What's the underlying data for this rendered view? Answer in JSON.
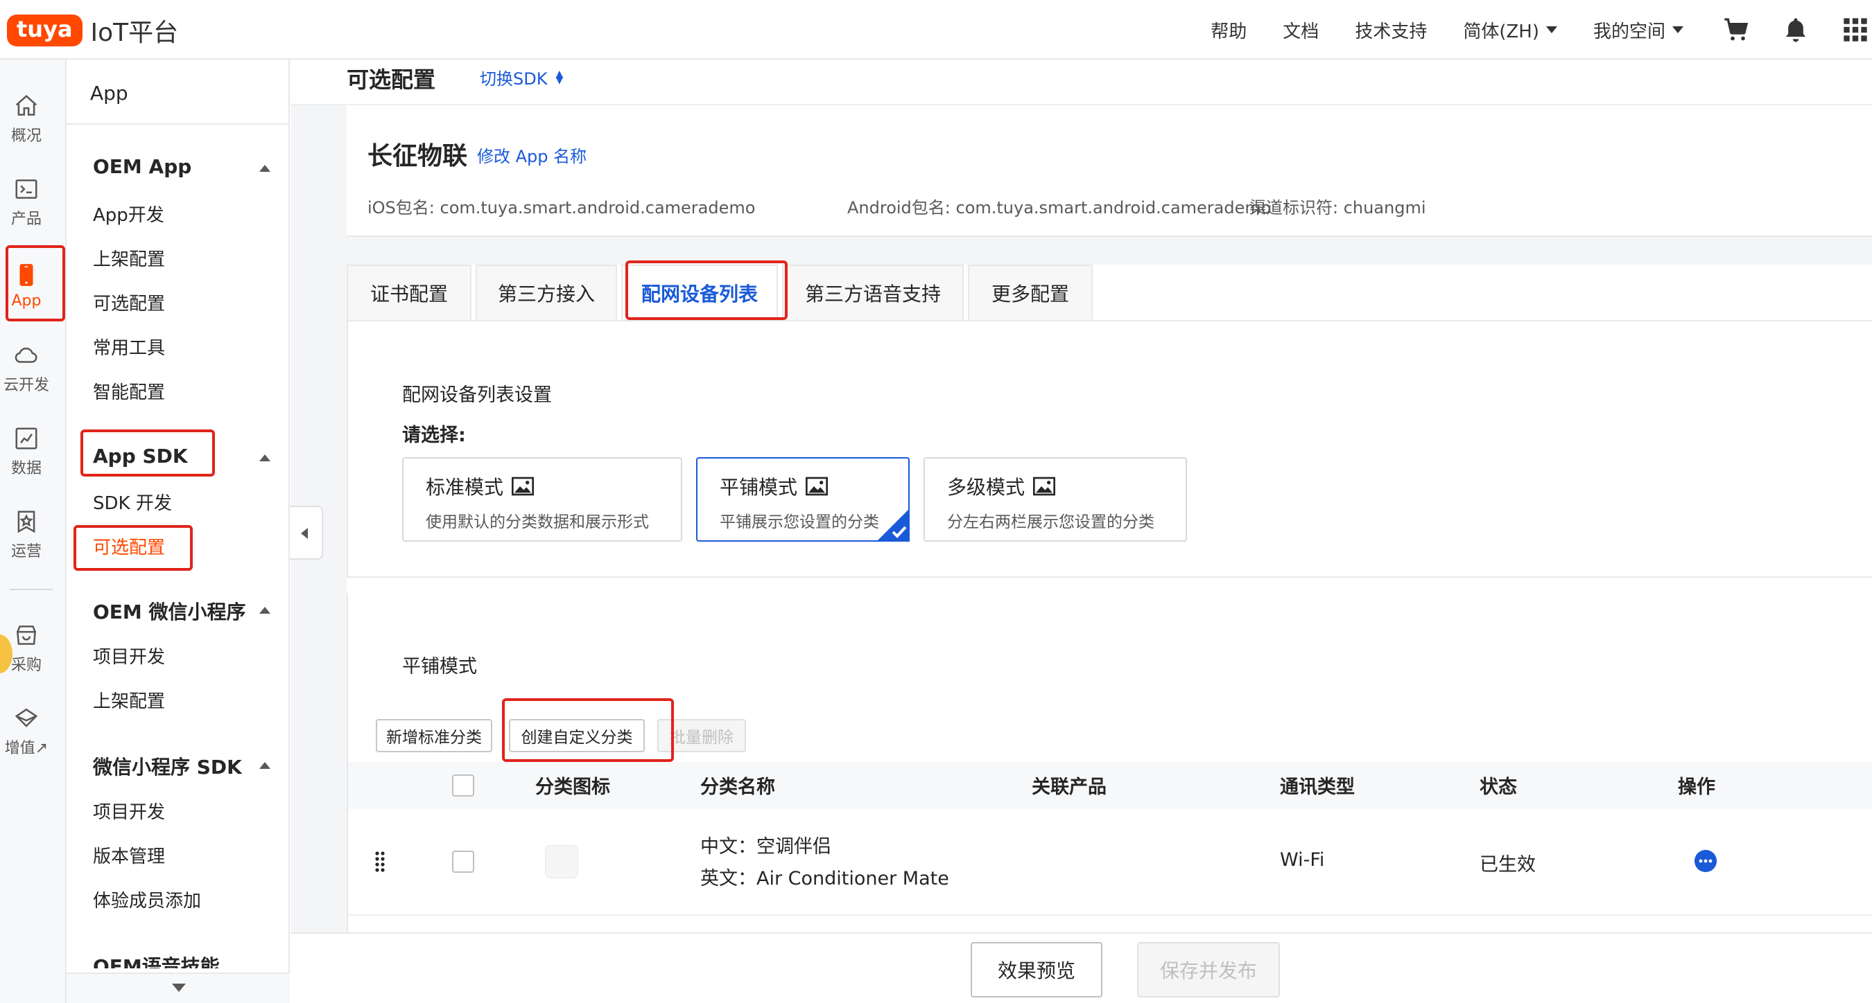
{
  "topbar": {
    "logo_badge": "tuya",
    "logo_text": "IoT平台",
    "links": {
      "help": "帮助",
      "docs": "文档",
      "support": "技术支持",
      "language": "简体(ZH)",
      "space": "我的空间"
    }
  },
  "rail": {
    "overview": "概况",
    "product": "产品",
    "app": "App",
    "cloud": "云开发",
    "data": "数据",
    "operation": "运营",
    "purchase": "采购",
    "value_added": "增值↗"
  },
  "sidebar": {
    "app": "App",
    "oem_app": "OEM App",
    "oem_items": [
      "App开发",
      "上架配置",
      "可选配置",
      "常用工具",
      "智能配置"
    ],
    "app_sdk": "App SDK",
    "sdk_items": [
      "SDK 开发",
      "可选配置"
    ],
    "oem_wechat": "OEM 微信小程序",
    "wechat_items": [
      "项目开发",
      "上架配置"
    ],
    "wechat_sdk": "微信小程序 SDK",
    "wechat_sdk_items": [
      "项目开发",
      "版本管理",
      "体验成员添加"
    ],
    "oem_voice": "OEM语音技能"
  },
  "page": {
    "title": "可选配置",
    "switch_sdk": "切换SDK"
  },
  "app_info": {
    "name": "长征物联",
    "rename": "修改 App 名称",
    "ios_pkg": "iOS包名: com.tuya.smart.android.camerademo",
    "android_pkg": "Android包名: com.tuya.smart.android.camerademo",
    "channel": "渠道标识符: chuangmi"
  },
  "tabs": [
    "证书配置",
    "第三方接入",
    "配网设备列表",
    "第三方语音支持",
    "更多配置"
  ],
  "device_list": {
    "title": "配网设备列表设置",
    "choose": "请选择:",
    "modes": [
      {
        "title": "标准模式",
        "desc": "使用默认的分类数据和展示形式"
      },
      {
        "title": "平铺模式",
        "desc": "平铺展示您设置的分类"
      },
      {
        "title": "多级模式",
        "desc": "分左右两栏展示您设置的分类"
      }
    ]
  },
  "tile": {
    "title": "平铺模式",
    "buttons": {
      "add_standard": "新增标准分类",
      "create_custom": "创建自定义分类",
      "batch_delete": "批量删除"
    },
    "columns": {
      "icon": "分类图标",
      "name": "分类名称",
      "product": "关联产品",
      "comm": "通讯类型",
      "status": "状态",
      "action": "操作"
    },
    "rows": [
      {
        "name_cn": "中文：空调伴侣",
        "name_en": "英文：Air Conditioner Mate",
        "comm": "Wi-Fi",
        "status": "已生效"
      }
    ]
  },
  "footer": {
    "preview": "效果预览",
    "publish": "保存并发布"
  },
  "colors": {
    "brand": "#ff4800",
    "link": "#1a5ad9",
    "highlight": "#e0241b"
  }
}
